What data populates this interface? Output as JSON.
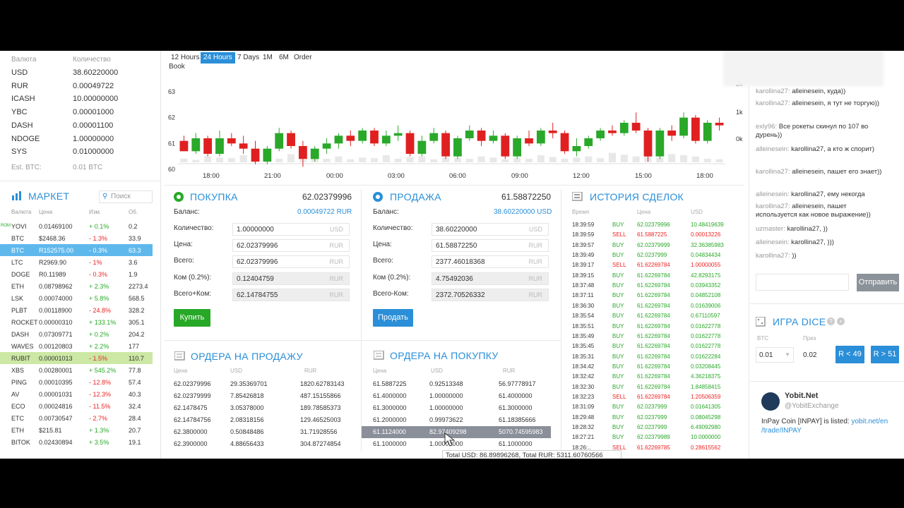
{
  "balances": {
    "col_currency": "Валюта",
    "col_amount": "Количество",
    "rows": [
      {
        "cur": "USD",
        "amt": "38.60220000"
      },
      {
        "cur": "RUR",
        "amt": "0.00049722"
      },
      {
        "cur": "ICASH",
        "amt": "10.00000000"
      },
      {
        "cur": "YBC",
        "amt": "0.00001000"
      },
      {
        "cur": "DASH",
        "amt": "0.00001100"
      },
      {
        "cur": "NDOGE",
        "amt": "1.00000000"
      },
      {
        "cur": "SYS",
        "amt": "0.01000000"
      }
    ],
    "est_label": "Est. BTC:",
    "est_value": "0.01 BTC"
  },
  "market": {
    "title": "МАРКЕТ",
    "search_placeholder": "Поиск",
    "cols": {
      "cur": "Валюта",
      "price": "Цена",
      "chg": "Изм.",
      "vol": "Об."
    },
    "rows": [
      {
        "badge": "ROM",
        "cur": "YOVI",
        "price": "0.01469100",
        "chg": "+ 0.1%",
        "dir": "pos",
        "vol": "0.2",
        "state": ""
      },
      {
        "badge": "",
        "cur": "BTC",
        "price": "$2468.36",
        "chg": "- 1.3%",
        "dir": "neg",
        "vol": "33.9",
        "state": ""
      },
      {
        "badge": "",
        "cur": "BTC",
        "price": "R152575.00",
        "chg": "- 0.3%",
        "dir": "neg",
        "vol": "63.3",
        "state": "sel"
      },
      {
        "badge": "",
        "cur": "LTC",
        "price": "R2969.90",
        "chg": "- 1%",
        "dir": "neg",
        "vol": "3.6",
        "state": ""
      },
      {
        "badge": "",
        "cur": "DOGE",
        "price": "R0.11989",
        "chg": "- 0.3%",
        "dir": "neg",
        "vol": "1.9",
        "state": ""
      },
      {
        "badge": "",
        "cur": "ETH",
        "price": "0.08798962",
        "chg": "+ 2.3%",
        "dir": "pos",
        "vol": "2273.4",
        "state": ""
      },
      {
        "badge": "",
        "cur": "LSK",
        "price": "0.00074000",
        "chg": "+ 5.8%",
        "dir": "pos",
        "vol": "568.5",
        "state": ""
      },
      {
        "badge": "",
        "cur": "PLBT",
        "price": "0.00118900",
        "chg": "- 24.8%",
        "dir": "neg",
        "vol": "328.2",
        "state": ""
      },
      {
        "badge": "",
        "cur": "ROCKET",
        "price": "0.00000310",
        "chg": "+ 133.1%",
        "dir": "pos",
        "vol": "305.1",
        "state": ""
      },
      {
        "badge": "",
        "cur": "DASH",
        "price": "0.07309771",
        "chg": "+ 0.2%",
        "dir": "pos",
        "vol": "204.2",
        "state": ""
      },
      {
        "badge": "",
        "cur": "WAVES",
        "price": "0.00120803",
        "chg": "+ 2.2%",
        "dir": "pos",
        "vol": "177",
        "state": ""
      },
      {
        "badge": "",
        "cur": "RUBIT",
        "price": "0.00001013",
        "chg": "- 1.5%",
        "dir": "neg",
        "vol": "110.7",
        "state": "hl"
      },
      {
        "badge": "",
        "cur": "XBS",
        "price": "0.00280001",
        "chg": "+ 545.2%",
        "dir": "pos",
        "vol": "77.8",
        "state": ""
      },
      {
        "badge": "",
        "cur": "PING",
        "price": "0.00010395",
        "chg": "- 12.8%",
        "dir": "neg",
        "vol": "57.4",
        "state": ""
      },
      {
        "badge": "",
        "cur": "AV",
        "price": "0.00001031",
        "chg": "- 12.3%",
        "dir": "neg",
        "vol": "40.3",
        "state": ""
      },
      {
        "badge": "",
        "cur": "ECO",
        "price": "0.00024816",
        "chg": "- 11.5%",
        "dir": "neg",
        "vol": "32.4",
        "state": ""
      },
      {
        "badge": "",
        "cur": "ETC",
        "price": "0.00730547",
        "chg": "- 2.7%",
        "dir": "neg",
        "vol": "28.4",
        "state": ""
      },
      {
        "badge": "",
        "cur": "ETH",
        "price": "$215.81",
        "chg": "+ 1.3%",
        "dir": "pos",
        "vol": "20.7",
        "state": ""
      },
      {
        "badge": "",
        "cur": "BITOK",
        "price": "0.02430894",
        "chg": "+ 3.5%",
        "dir": "pos",
        "vol": "19.1",
        "state": ""
      }
    ]
  },
  "chart": {
    "ranges": [
      "12 Hours",
      "24 Hours",
      "7 Days",
      "1M",
      "6M",
      "Order"
    ],
    "range_second_line": "Book",
    "active_range": 1,
    "yticks": [
      "63",
      "62",
      "61",
      "60"
    ],
    "ytick_vals": [
      63,
      62,
      61,
      60
    ],
    "vol_ticks": [
      "2k",
      "1k",
      "0k"
    ],
    "xticks": [
      "18:00",
      "21:00",
      "00:00",
      "03:00",
      "06:00",
      "09:00",
      "12:00",
      "15:00",
      "18:00"
    ]
  },
  "chart_data": {
    "type": "candlestick",
    "ylim": [
      60,
      63
    ],
    "volume_ylim": [
      0,
      2400
    ],
    "x_start": "16:30",
    "x_end": "19:30",
    "up_color": "#2aa82a",
    "down_color": "#e02020",
    "candles": [
      [
        61.1,
        61.3,
        60.8,
        60.7
      ],
      [
        60.7,
        61.4,
        60.6,
        61.2
      ],
      [
        61.2,
        61.3,
        60.5,
        60.6
      ],
      [
        60.6,
        61.5,
        60.5,
        61.2
      ],
      [
        61.2,
        61.4,
        60.9,
        61.0
      ],
      [
        61.0,
        61.3,
        60.6,
        60.8
      ],
      [
        60.8,
        61.1,
        60.2,
        60.3
      ],
      [
        60.3,
        60.9,
        60.2,
        60.8
      ],
      [
        60.8,
        61.6,
        60.7,
        61.4
      ],
      [
        61.4,
        61.5,
        60.8,
        60.9
      ],
      [
        60.9,
        61.1,
        60.1,
        60.4
      ],
      [
        60.4,
        60.9,
        60.3,
        60.8
      ],
      [
        60.8,
        61.2,
        60.6,
        61.0
      ],
      [
        61.0,
        61.4,
        60.8,
        61.3
      ],
      [
        61.3,
        61.5,
        60.9,
        61.1
      ],
      [
        61.1,
        61.6,
        61.0,
        61.5
      ],
      [
        61.5,
        61.6,
        60.9,
        61.0
      ],
      [
        61.0,
        61.5,
        60.9,
        61.3
      ],
      [
        61.3,
        61.7,
        61.1,
        61.4
      ],
      [
        61.4,
        61.5,
        60.5,
        60.6
      ],
      [
        60.6,
        61.3,
        60.5,
        61.1
      ],
      [
        61.1,
        61.6,
        61.0,
        61.4
      ],
      [
        61.4,
        61.5,
        60.4,
        60.5
      ],
      [
        60.5,
        61.3,
        60.4,
        61.2
      ],
      [
        61.2,
        61.7,
        61.1,
        61.5
      ],
      [
        61.5,
        61.6,
        60.9,
        61.1
      ],
      [
        61.1,
        61.5,
        61.0,
        61.3
      ],
      [
        61.3,
        61.4,
        60.4,
        60.5
      ],
      [
        60.5,
        61.3,
        60.4,
        61.2
      ],
      [
        61.2,
        61.5,
        60.9,
        61.0
      ],
      [
        61.0,
        61.6,
        60.9,
        61.5
      ],
      [
        61.5,
        61.8,
        61.2,
        61.4
      ],
      [
        61.4,
        61.5,
        60.6,
        60.7
      ],
      [
        60.7,
        61.2,
        60.5,
        60.9
      ],
      [
        60.9,
        61.3,
        60.8,
        61.2
      ],
      [
        61.2,
        61.6,
        61.1,
        61.5
      ],
      [
        61.5,
        61.7,
        61.3,
        61.4
      ],
      [
        61.4,
        61.9,
        61.3,
        61.8
      ],
      [
        61.8,
        62.2,
        61.4,
        61.5
      ],
      [
        61.5,
        61.6,
        60.3,
        60.5
      ],
      [
        60.5,
        61.6,
        60.4,
        61.5
      ],
      [
        61.5,
        61.7,
        61.1,
        61.3
      ],
      [
        61.3,
        62.2,
        61.2,
        62.0
      ],
      [
        62.0,
        62.1,
        61.0,
        61.1
      ],
      [
        61.1,
        61.9,
        61.0,
        61.8
      ],
      [
        61.8,
        62.0,
        61.5,
        61.7
      ]
    ],
    "volumes": [
      300,
      200,
      500,
      400,
      350,
      600,
      250,
      400,
      300,
      700,
      200,
      450,
      300,
      500,
      250,
      400,
      350,
      600,
      300,
      450,
      500,
      250,
      400,
      350,
      300,
      500,
      400,
      250,
      350,
      300,
      600,
      450,
      300,
      400,
      500,
      350,
      800,
      650,
      500,
      900,
      400,
      700,
      600,
      500,
      300,
      250
    ]
  },
  "buy": {
    "title": "ПОКУПКА",
    "price": "62.02379996",
    "balance_label": "Баланс:",
    "balance_value": "0.00049722 RUR",
    "qty_label": "Количество:",
    "qty_value": "1.00000000",
    "qty_cur": "USD",
    "price_label": "Цена:",
    "price_value": "62.02379996",
    "price_cur": "RUR",
    "total_label": "Всего:",
    "total_value": "62.02379996",
    "total_cur": "RUR",
    "fee_label": "Ком (0.2%):",
    "fee_value": "0.12404759",
    "fee_cur": "RUR",
    "grand_label": "Всего+Ком:",
    "grand_value": "62.14784755",
    "grand_cur": "RUR",
    "button": "Купить"
  },
  "sell": {
    "title": "ПРОДАЖА",
    "price": "61.58872250",
    "balance_label": "Баланс:",
    "balance_value": "38.60220000 USD",
    "qty_label": "Количество:",
    "qty_value": "38.60220000",
    "qty_cur": "USD",
    "price_label": "Цена:",
    "price_value": "61.58872250",
    "price_cur": "RUR",
    "total_label": "Всего:",
    "total_value": "2377.46018368",
    "total_cur": "RUR",
    "fee_label": "Ком (0.2%):",
    "fee_value": "4.75492036",
    "fee_cur": "RUR",
    "grand_label": "Всего-Ком:",
    "grand_value": "2372.70526332",
    "grand_cur": "RUR",
    "button": "Продать"
  },
  "sell_orders": {
    "title": "ОРДЕРА НА ПРОДАЖУ",
    "cols": [
      "Цена",
      "USD",
      "RUR"
    ],
    "rows": [
      [
        "62.02379996",
        "29.35369701",
        "1820.62783143"
      ],
      [
        "62.02379999",
        "7.85426818",
        "487.15155866"
      ],
      [
        "62.1478475",
        "3.05378000",
        "189.78585373"
      ],
      [
        "62.14784756",
        "2.08318156",
        "129.46525003"
      ],
      [
        "62.3800000",
        "0.50848486",
        "31.71928556"
      ],
      [
        "62.3900000",
        "4.88656433",
        "304.87274854"
      ]
    ]
  },
  "buy_orders": {
    "title": "ОРДЕРА НА ПОКУПКУ",
    "cols": [
      "Цена",
      "USD",
      "RUR"
    ],
    "rows": [
      [
        "61.5887225",
        "0.92513348",
        "56.97778917"
      ],
      [
        "61.4000000",
        "1.00000000",
        "61.4000000"
      ],
      [
        "61.3000000",
        "1.00000000",
        "61.3000000"
      ],
      [
        "61.2000000",
        "0.99973622",
        "61.18385666"
      ],
      [
        "61.1124000",
        "82.97409298",
        "5070.74595983"
      ],
      [
        "61.1000000",
        "1.00000000",
        "61.1000000"
      ]
    ],
    "highlight_row": 4,
    "tooltip": "Total USD: 86.89896268, Total RUR: 5311.60760566"
  },
  "history": {
    "title": "ИСТОРИЯ СДЕЛОК",
    "cols": [
      "Время",
      "",
      "Цена",
      "USD"
    ],
    "rows": [
      [
        "18:39:59",
        "BUY",
        "62.02379996",
        "10.48419639"
      ],
      [
        "18:39:59",
        "SELL",
        "61.5887225",
        "0.00013226"
      ],
      [
        "18:39:57",
        "BUY",
        "62.02379999",
        "32.36385983"
      ],
      [
        "18:39:49",
        "BUY",
        "62.0237999",
        "0.04834434"
      ],
      [
        "18:39:17",
        "SELL",
        "61.62269784",
        "1.00000055"
      ],
      [
        "18:39:15",
        "BUY",
        "61.62269784",
        "42.8293175"
      ],
      [
        "18:37:48",
        "BUY",
        "61.62269784",
        "0.03943352"
      ],
      [
        "18:37:11",
        "BUY",
        "61.62269784",
        "0.04852108"
      ],
      [
        "18:36:30",
        "BUY",
        "61.62269784",
        "0.01639006"
      ],
      [
        "18:35:54",
        "BUY",
        "61.62269784",
        "0.67110597"
      ],
      [
        "18:35:51",
        "BUY",
        "61.62269784",
        "0.01622778"
      ],
      [
        "18:35:49",
        "BUY",
        "61.62269784",
        "0.01622778"
      ],
      [
        "18:35:45",
        "BUY",
        "61.62269784",
        "0.01622778"
      ],
      [
        "18:35:31",
        "BUY",
        "61.62269784",
        "0.01622284"
      ],
      [
        "18:34:42",
        "BUY",
        "61.62269784",
        "0.03208445"
      ],
      [
        "18:32:42",
        "BUY",
        "61.62269784",
        "4.36218375"
      ],
      [
        "18:32:30",
        "BUY",
        "61.62269784",
        "1.84858415"
      ],
      [
        "18:32:23",
        "SELL",
        "61.62269784",
        "1.20506359"
      ],
      [
        "18:31:09",
        "BUY",
        "62.0237999",
        "0.01641305"
      ],
      [
        "18:29:48",
        "BUY",
        "62.0237999",
        "0.08045298"
      ],
      [
        "18:28:32",
        "BUY",
        "62.0237999",
        "6.49092980"
      ],
      [
        "18:27:21",
        "BUY",
        "62.02379989",
        "10.0000000"
      ],
      [
        "18:26:..",
        "SELL",
        "61.62269785",
        "0.28615562"
      ]
    ]
  },
  "chat": {
    "messages": [
      {
        "user": "karollina27:",
        "text": " alleinesein, куда))"
      },
      {
        "user": "karollina27:",
        "text": " alleinesein, я тут не торгую))"
      },
      {
        "user": "exly96:",
        "text": " Все рокеты скинул по 107 во дурень))"
      },
      {
        "user": "alleinesein:",
        "text": " karollina27, а кто ж спорит)"
      },
      {
        "user": "karollina27:",
        "text": " alleinesein, пашет его знает))"
      },
      {
        "user": "alleinesein:",
        "text": " karollina27, ему некогда"
      },
      {
        "user": "karollina27:",
        "text": " alleinesein, пашет используется как новое выражение))"
      },
      {
        "user": "uzmaster:",
        "text": " karollina27, ))"
      },
      {
        "user": "alleinesein:",
        "text": " karollina27, )))"
      },
      {
        "user": "karollina27:",
        "text": " ))"
      }
    ],
    "send_button": "Отправить"
  },
  "dice": {
    "title": "ИГРА DICE",
    "col_bet": "BTC",
    "col_prize": "Приз",
    "bet_value": "0.01",
    "prize_value": "0.02",
    "btn_low": "R < 49",
    "btn_high": "R > 51"
  },
  "tweet": {
    "name": "Yobit.Net",
    "handle": "@YobitExchange",
    "text": "InPay Coin [INPAY] is listed: ",
    "link": "yobit.net/en",
    "link2": "/trade/INPAY"
  }
}
